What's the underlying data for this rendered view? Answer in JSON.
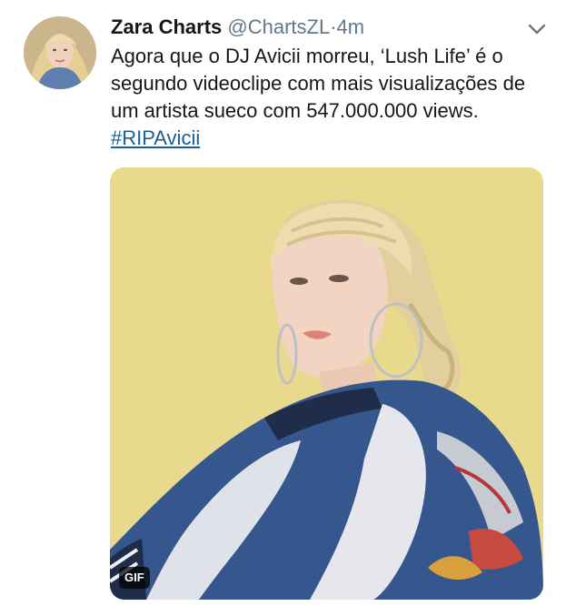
{
  "tweet": {
    "author_name": "Zara Charts",
    "handle": "@ChartsZL",
    "separator": "·",
    "time": "4m",
    "text": "Agora que o DJ Avicii morreu, ‘Lush Life’ é o segundo videoclipe com mais visualizações de um artista sueco com 547.000.000 views.",
    "hashtag": "#RIPAvicii",
    "media": {
      "badge": "GIF",
      "background_color": "#e9d98c"
    }
  },
  "icons": {
    "menu": "chevron-down-icon"
  },
  "colors": {
    "text": "#14171a",
    "secondary": "#657786",
    "link": "#1b5e95"
  }
}
